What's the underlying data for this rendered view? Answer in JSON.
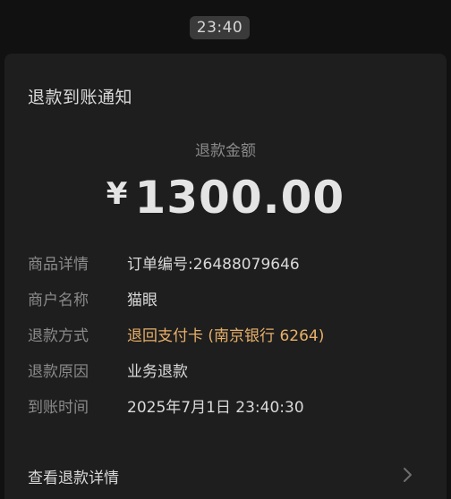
{
  "status": {
    "time": "23:40"
  },
  "card": {
    "title": "退款到账通知",
    "amount_label": "退款金额",
    "currency_symbol": "¥",
    "amount": "1300.00",
    "details": [
      {
        "label": "商品详情",
        "value": "订单编号:26488079646"
      },
      {
        "label": "商户名称",
        "value": "猫眼"
      },
      {
        "label": "退款方式",
        "value": "退回支付卡 (南京银行 6264)"
      },
      {
        "label": "退款原因",
        "value": "业务退款"
      },
      {
        "label": "到账时间",
        "value": "2025年7月1日 23:40:30"
      }
    ],
    "link_text": "查看退款详情"
  },
  "colors": {
    "background": "#111111",
    "card": "#1e1e1e",
    "accent": "#e8b06a"
  },
  "icons": {
    "detail_link": "chevron-right-icon"
  }
}
